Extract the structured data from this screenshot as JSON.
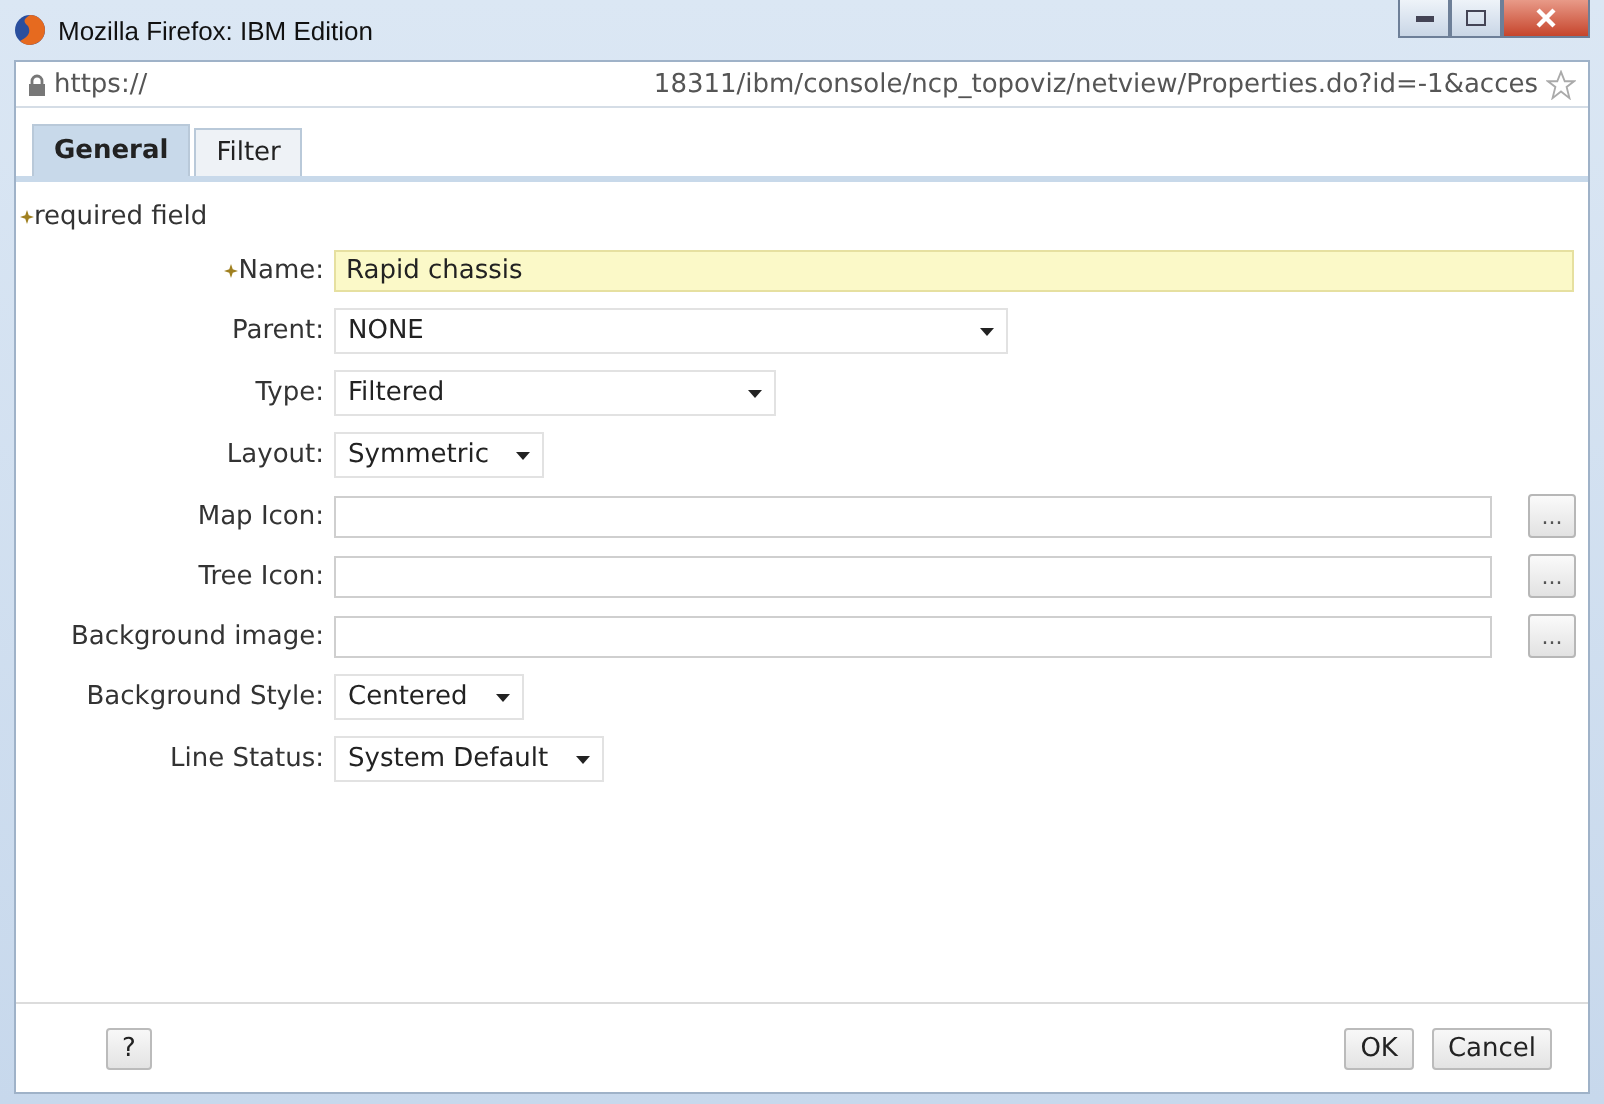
{
  "window": {
    "title": "Mozilla Firefox: IBM Edition"
  },
  "address_bar": {
    "scheme": "https://",
    "path": "18311/ibm/console/ncp_topoviz/netview/Properties.do?id=-1&acces"
  },
  "tabs": [
    {
      "label": "General",
      "selected": true
    },
    {
      "label": "Filter",
      "selected": false
    }
  ],
  "required_note": "required field",
  "fields": [
    {
      "kind": "text",
      "label": "Name:",
      "required": true,
      "value": "Rapid chassis"
    },
    {
      "kind": "select",
      "label": "Parent:",
      "required": false,
      "value": "NONE"
    },
    {
      "kind": "select",
      "label": "Type:",
      "required": false,
      "value": "Filtered"
    },
    {
      "kind": "select",
      "label": "Layout:",
      "required": false,
      "value": "Symmetric"
    },
    {
      "kind": "file",
      "label": "Map Icon:",
      "required": false,
      "browse": "..."
    },
    {
      "kind": "file",
      "label": "Tree Icon:",
      "required": false,
      "browse": "..."
    },
    {
      "kind": "file",
      "label": "Background image:",
      "required": false,
      "browse": "..."
    },
    {
      "kind": "select",
      "label": "Background Style:",
      "required": false,
      "value": "Centered"
    },
    {
      "kind": "select",
      "label": "Line Status:",
      "required": false,
      "value": "System Default"
    }
  ],
  "buttons": {
    "help": "?",
    "ok": "OK",
    "cancel": "Cancel"
  }
}
